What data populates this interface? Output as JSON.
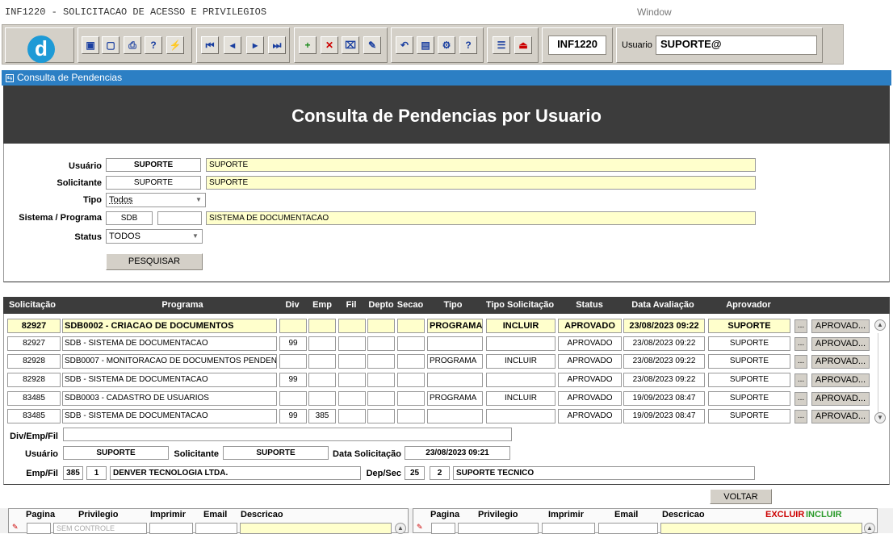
{
  "window": {
    "title": "INF1220 - SOLICITACAO DE ACESSO E PRIVILEGIOS",
    "window_label": "Window"
  },
  "toolbar": {
    "logo": "d",
    "buttons": [
      {
        "name": "save-icon",
        "glyph": "▣"
      },
      {
        "name": "window-icon",
        "glyph": "▢"
      },
      {
        "name": "print-icon",
        "glyph": "⎙"
      },
      {
        "name": "query-icon",
        "glyph": "?"
      },
      {
        "name": "execute-query-icon",
        "glyph": "⚡"
      },
      {
        "name": "first-record-icon",
        "glyph": "⏮"
      },
      {
        "name": "previous-record-icon",
        "glyph": "◂"
      },
      {
        "name": "next-record-icon",
        "glyph": "▸"
      },
      {
        "name": "last-record-icon",
        "glyph": "⏭"
      },
      {
        "name": "insert-record-icon",
        "glyph": "+"
      },
      {
        "name": "delete-record-icon",
        "glyph": "✕"
      },
      {
        "name": "clear-record-icon",
        "glyph": "⌧"
      },
      {
        "name": "edit-icon",
        "glyph": "✎"
      },
      {
        "name": "undo-icon",
        "glyph": "↶"
      },
      {
        "name": "clipboard-icon",
        "glyph": "📋"
      },
      {
        "name": "tools-icon",
        "glyph": "⚙"
      },
      {
        "name": "help-icon",
        "glyph": "?"
      },
      {
        "name": "menu-icon",
        "glyph": "☰"
      },
      {
        "name": "exit-icon",
        "glyph": "⏏"
      }
    ],
    "form_code": "INF1220",
    "user_label": "Usuario",
    "user_value": "SUPORTE@"
  },
  "panel": {
    "title": "Consulta de Pendencias",
    "banner": "Consulta de Pendencias por Usuario"
  },
  "filters": {
    "usuario": {
      "label": "Usuário",
      "code": "SUPORTE",
      "name": "SUPORTE"
    },
    "solicitante": {
      "label": "Solicitante",
      "code": "SUPORTE",
      "name": "SUPORTE"
    },
    "tipo": {
      "label": "Tipo",
      "value": "Todos"
    },
    "sistema": {
      "label": "Sistema / Programa",
      "code": "SDB",
      "program": "",
      "name": "SISTEMA DE DOCUMENTACAO"
    },
    "status": {
      "label": "Status",
      "value": "TODOS"
    },
    "search_button": "PESQUISAR"
  },
  "grid": {
    "columns": [
      "Solicitação",
      "Programa",
      "Div",
      "Emp",
      "Fil",
      "Depto",
      "Secao",
      "Tipo",
      "Tipo Solicitação",
      "Status",
      "Data Avaliação",
      "Aprovador"
    ],
    "rows": [
      {
        "sol": "82927",
        "prog": "SDB0002 - CRIACAO DE DOCUMENTOS",
        "div": "",
        "emp": "",
        "fil": "",
        "depto": "",
        "secao": "",
        "tipo": "PROGRAMA",
        "tipo_sol": "INCLUIR",
        "status": "APROVADO",
        "data": "23/08/2023 09:22",
        "aprov": "SUPORTE",
        "btn": "APROVAD..."
      },
      {
        "sol": "82927",
        "prog": "SDB - SISTEMA DE DOCUMENTACAO",
        "div": "99",
        "emp": "",
        "fil": "",
        "depto": "",
        "secao": "",
        "tipo": "",
        "tipo_sol": "",
        "status": "APROVADO",
        "data": "23/08/2023 09:22",
        "aprov": "SUPORTE",
        "btn": "APROVAD..."
      },
      {
        "sol": "82928",
        "prog": "SDB0007 - MONITORACAO DE DOCUMENTOS PENDENTES",
        "div": "",
        "emp": "",
        "fil": "",
        "depto": "",
        "secao": "",
        "tipo": "PROGRAMA",
        "tipo_sol": "INCLUIR",
        "status": "APROVADO",
        "data": "23/08/2023 09:22",
        "aprov": "SUPORTE",
        "btn": "APROVAD..."
      },
      {
        "sol": "82928",
        "prog": "SDB - SISTEMA DE DOCUMENTACAO",
        "div": "99",
        "emp": "",
        "fil": "",
        "depto": "",
        "secao": "",
        "tipo": "",
        "tipo_sol": "",
        "status": "APROVADO",
        "data": "23/08/2023 09:22",
        "aprov": "SUPORTE",
        "btn": "APROVAD..."
      },
      {
        "sol": "83485",
        "prog": "SDB0003 - CADASTRO DE USUARIOS",
        "div": "",
        "emp": "",
        "fil": "",
        "depto": "",
        "secao": "",
        "tipo": "PROGRAMA",
        "tipo_sol": "INCLUIR",
        "status": "APROVADO",
        "data": "19/09/2023 08:47",
        "aprov": "SUPORTE",
        "btn": "APROVAD..."
      },
      {
        "sol": "83485",
        "prog": "SDB - SISTEMA DE DOCUMENTACAO",
        "div": "99",
        "emp": "385",
        "fil": "",
        "depto": "",
        "secao": "",
        "tipo": "",
        "tipo_sol": "",
        "status": "APROVADO",
        "data": "19/09/2023 08:47",
        "aprov": "SUPORTE",
        "btn": "APROVAD..."
      }
    ]
  },
  "details": {
    "div_emp_fil_label": "Div/Emp/Fil",
    "div_emp_fil_value": "",
    "usuario_label": "Usuário",
    "usuario_value": "SUPORTE",
    "solicitante_label": "Solicitante",
    "solicitante_value": "SUPORTE",
    "data_sol_label": "Data Solicitação",
    "data_sol_value": "23/08/2023 09:21",
    "empfil_label": "Emp/Fil",
    "emp": "385",
    "fil": "1",
    "empresa": "DENVER TECNOLOGIA LTDA.",
    "depsec_label": "Dep/Sec",
    "dep": "25",
    "sec": "2",
    "secao": "SUPORTE TECNICO"
  },
  "voltar_button": "VOLTAR",
  "bottom_left": {
    "cols": [
      "Pagina",
      "Privilegio",
      "Imprimir",
      "Email",
      "Descricao"
    ],
    "privilegio_value": "SEM CONTROLE"
  },
  "bottom_right": {
    "cols": [
      "Pagina",
      "Privilegio",
      "Imprimir",
      "Email",
      "Descricao"
    ],
    "excluir": "EXCLUIR",
    "incluir": "INCLUIR"
  },
  "colors": {
    "header_blue": "#2c7fc4",
    "banner_dark": "#3c3c3c",
    "highlight_yellow": "#ffffcc",
    "excluir_red": "#cc0000",
    "incluir_green": "#2a9a2a"
  }
}
